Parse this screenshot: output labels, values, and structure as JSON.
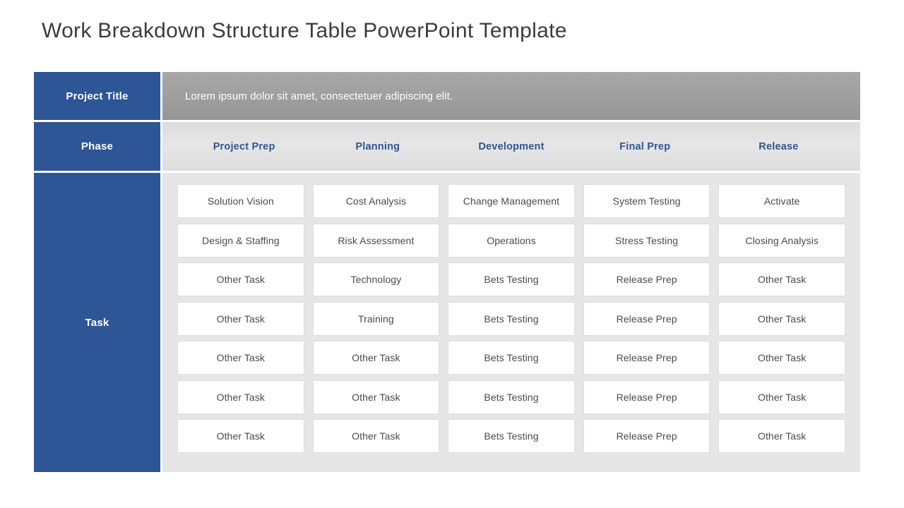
{
  "slide": {
    "title": "Work Breakdown Structure Table PowerPoint Template"
  },
  "colors": {
    "accent_blue": "#2e5596",
    "header_gray": "#9e9e9e",
    "phase_gray": "#e3e4e6",
    "body_gray": "#e6e6e6",
    "cell_white": "#ffffff",
    "title_text": "#3c3c3c",
    "cell_text": "#4a4a4a"
  },
  "table": {
    "project_row": {
      "label": "Project Title",
      "value": "Lorem ipsum dolor sit amet, consectetuer adipiscing elit."
    },
    "phase_row": {
      "label": "Phase",
      "phases": [
        "Project Prep",
        "Planning",
        "Development",
        "Final Prep",
        "Release"
      ]
    },
    "task_row": {
      "label": "Task",
      "rows": [
        [
          "Solution Vision",
          "Cost Analysis",
          "Change Management",
          "System Testing",
          "Activate"
        ],
        [
          "Design & Staffing",
          "Risk Assessment",
          "Operations",
          "Stress Testing",
          "Closing Analysis"
        ],
        [
          "Other Task",
          "Technology",
          "Bets Testing",
          "Release Prep",
          "Other Task"
        ],
        [
          "Other Task",
          "Training",
          "Bets Testing",
          "Release Prep",
          "Other Task"
        ],
        [
          "Other Task",
          "Other Task",
          "Bets Testing",
          "Release Prep",
          "Other Task"
        ],
        [
          "Other Task",
          "Other Task",
          "Bets Testing",
          "Release Prep",
          "Other Task"
        ],
        [
          "Other Task",
          "Other Task",
          "Bets Testing",
          "Release Prep",
          "Other Task"
        ]
      ]
    }
  }
}
